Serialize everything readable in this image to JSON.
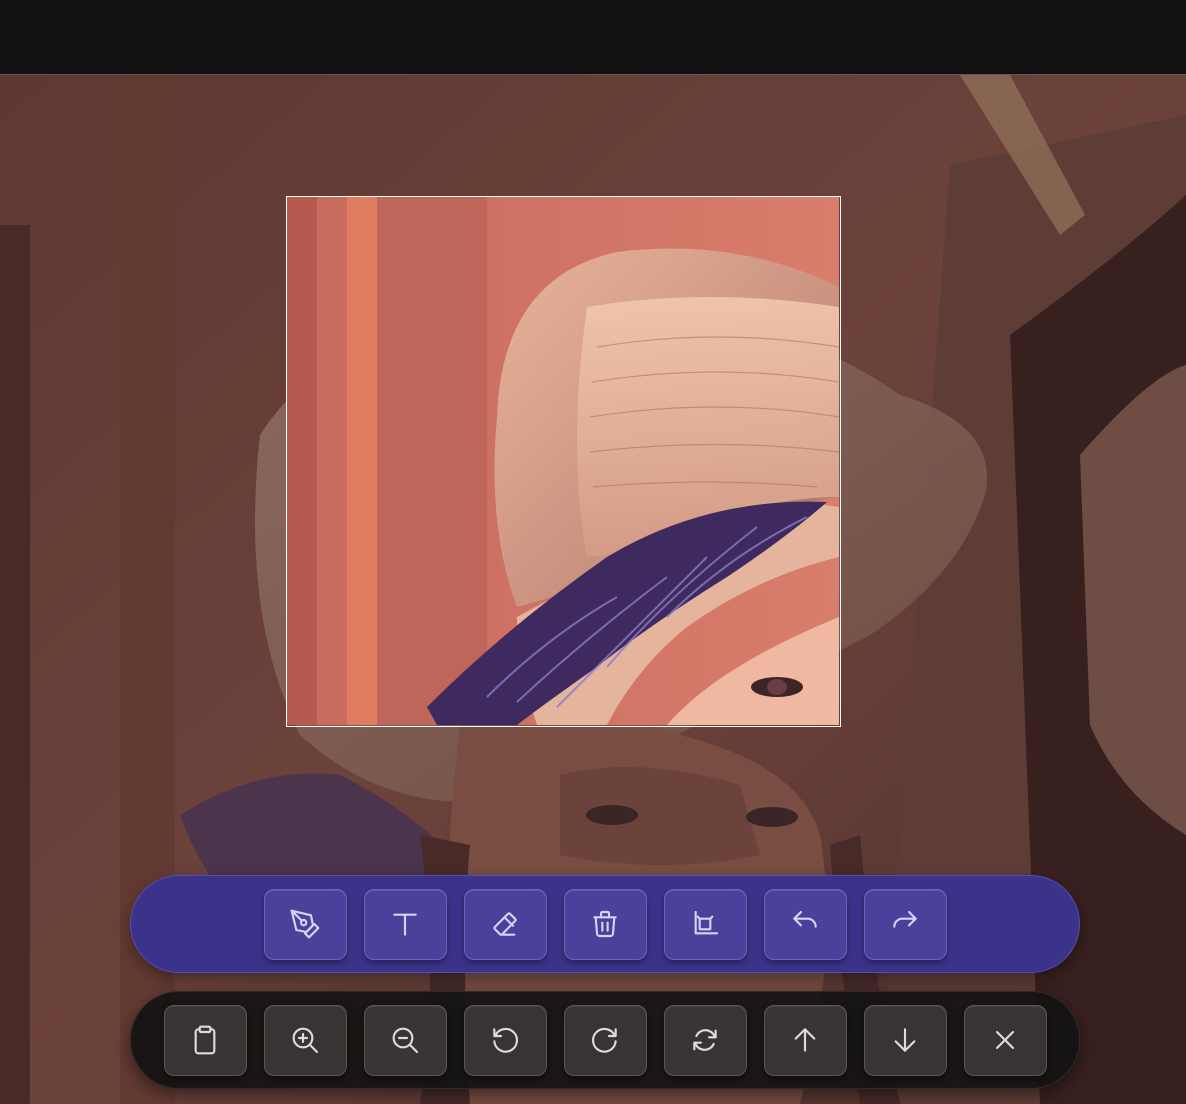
{
  "app": {
    "mode": "crop",
    "accent_color": "#3b3389"
  },
  "edit_toolbar": {
    "items": [
      {
        "icon": "pen-icon",
        "label": "Draw"
      },
      {
        "icon": "text-icon",
        "label": "Text"
      },
      {
        "icon": "eraser-icon",
        "label": "Erase"
      },
      {
        "icon": "trash-icon",
        "label": "Delete"
      },
      {
        "icon": "crop-icon",
        "label": "Crop"
      },
      {
        "icon": "undo-icon",
        "label": "Undo"
      },
      {
        "icon": "redo-icon",
        "label": "Redo"
      }
    ]
  },
  "view_toolbar": {
    "items": [
      {
        "icon": "clipboard-icon",
        "label": "Copy to clipboard"
      },
      {
        "icon": "zoom-in-icon",
        "label": "Zoom in"
      },
      {
        "icon": "zoom-out-icon",
        "label": "Zoom out"
      },
      {
        "icon": "rotate-left-icon",
        "label": "Rotate left"
      },
      {
        "icon": "rotate-right-icon",
        "label": "Rotate right"
      },
      {
        "icon": "refresh-icon",
        "label": "Reset"
      },
      {
        "icon": "arrow-up-icon",
        "label": "Previous"
      },
      {
        "icon": "arrow-down-icon",
        "label": "Next"
      },
      {
        "icon": "close-icon",
        "label": "Close"
      }
    ]
  }
}
